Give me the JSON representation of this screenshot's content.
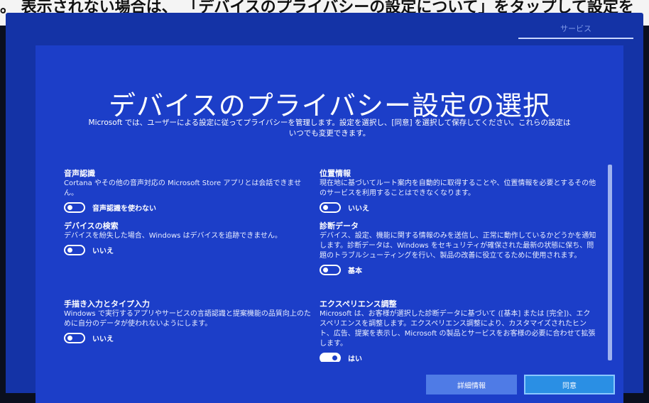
{
  "top_caption": "。 表示されない場合は、 「デバイスのプライバシーの設定について」をタップして設定を",
  "top_tab": "サービス",
  "title": "デバイスのプライバシー設定の選択",
  "subtitle": "Microsoft では、ユーザーによる設定に従ってプライバシーを管理します。設定を選択し、[同意] を選択して保存してください。これらの設定はいつでも変更できます。",
  "settings": [
    {
      "heading": "音声認識",
      "description": "Cortana やその他の音声対応の Microsoft Store アプリとは会話できません。",
      "toggle_label": "音声認識を使わない",
      "on": false
    },
    {
      "heading": "デバイスの検索",
      "description": "デバイスを紛失した場合、Windows はデバイスを追跡できません。",
      "toggle_label": "いいえ",
      "on": false
    },
    {
      "heading": "手描き入力とタイプ入力",
      "description": "Windows で実行するアプリやサービスの言語認識と提案機能の品質向上のために自分のデータが使われないようにします。",
      "toggle_label": "いいえ",
      "on": false
    },
    {
      "heading": "位置情報",
      "description": "現在地に基づいてルート案内を自動的に取得することや、位置情報を必要とするその他のサービスを利用することはできなくなります。",
      "toggle_label": "いいえ",
      "on": false
    },
    {
      "heading": "診断データ",
      "description": "デバイス、設定、機能に関する情報のみを送信し、正常に動作しているかどうかを通知します。診断データは、Windows をセキュリティが確保された最新の状態に保ち、問題のトラブルシューティングを行い、製品の改善に役立てるために使用されます。",
      "toggle_label": "基本",
      "on": false
    },
    {
      "heading": "エクスペリエンス調整",
      "description": "Microsoft は、お客様が選択した診断データに基づいて ([基本] または [完全])、エクスペリエンスを調整します。エクスペリエンス調整により、カスタマイズされたヒント、広告、提案を表示し、Microsoft の製品とサービスをお客様の必要に合わせて拡張します。",
      "toggle_label": "はい",
      "on": true
    }
  ],
  "buttons": {
    "details": "詳細情報",
    "agree": "同意"
  }
}
